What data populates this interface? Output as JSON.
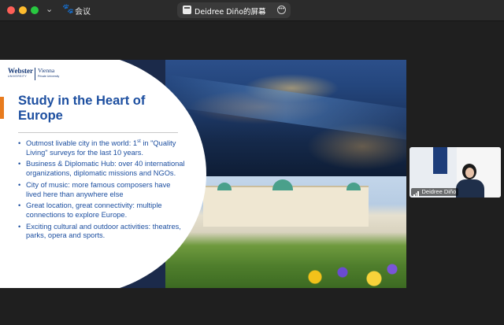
{
  "topbar": {
    "meeting_label": "会议",
    "share_title": "Deidree Diño的屏幕"
  },
  "slide": {
    "logo_main": "Webster",
    "logo_sub": "UNIVERSITY",
    "logo_city": "Vienna",
    "logo_city_sub": "Private University",
    "headline": "Study in the Heart of Europe",
    "bullets": [
      {
        "pre": "Outmost livable city in the world: 1",
        "sup": "st",
        "post": " in \"Quality Living\" surveys for the last 10 years."
      },
      {
        "text": "Business & Diplomatic Hub: over 40 international organizations, diplomatic missions and NGOs."
      },
      {
        "text": "City of music: more famous composers have lived here than anywhere else"
      },
      {
        "text": "Great location, great connectivity: multiple connections to explore Europe."
      },
      {
        "text": "Exciting cultural and outdoor activities: theatres, parks, opera and sports."
      }
    ]
  },
  "participant": {
    "name": "Deidree Diño"
  }
}
